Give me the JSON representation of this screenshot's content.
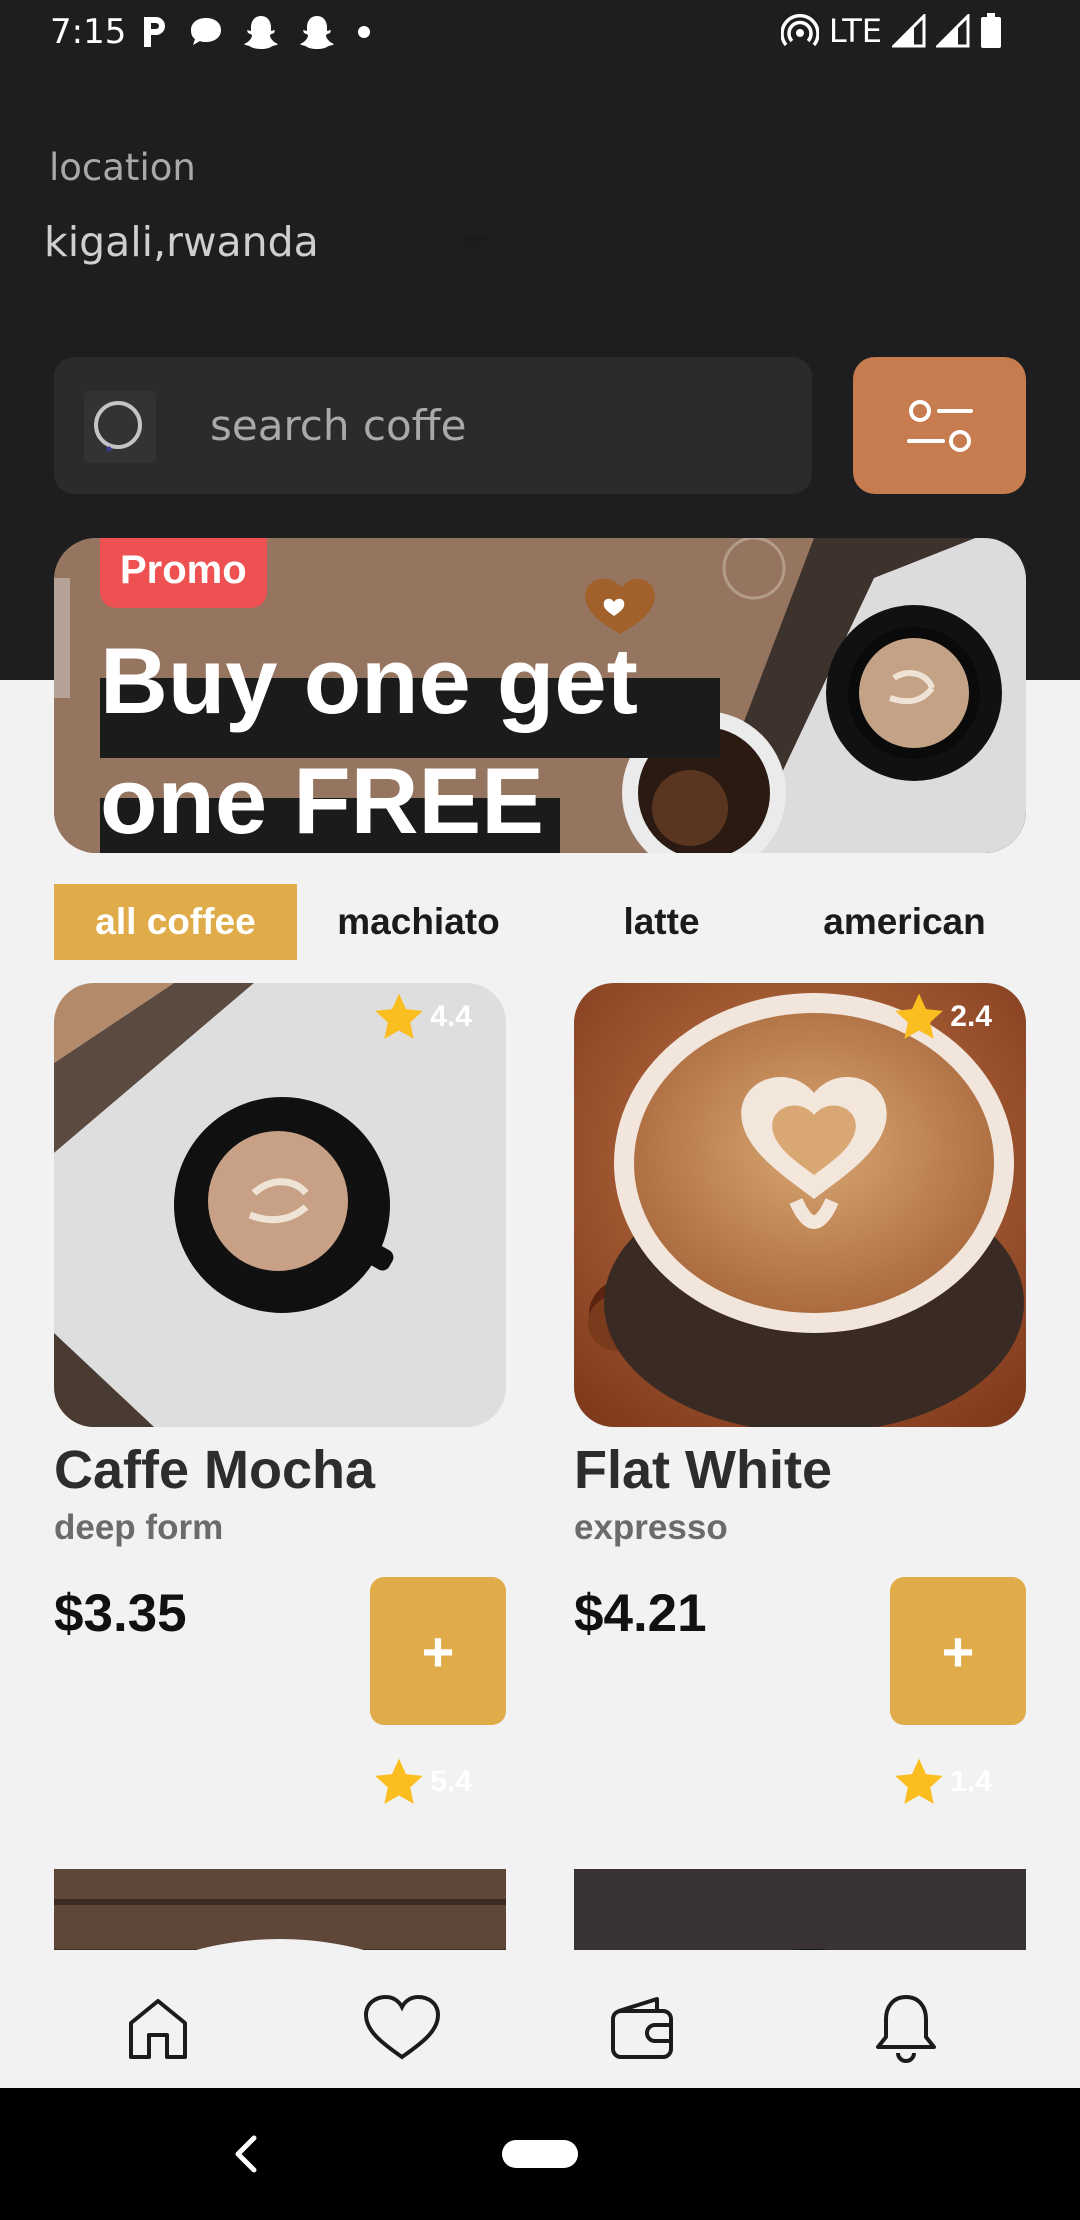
{
  "status_bar": {
    "time": "7:15",
    "network": "LTE",
    "icons": [
      "parking-icon",
      "chat-icon",
      "snapchat-icon",
      "snapchat-icon",
      "dot-icon",
      "hotspot-icon",
      "signal-icon",
      "signal-icon",
      "battery-icon"
    ]
  },
  "location": {
    "label": "location",
    "value": "kigali,rwanda"
  },
  "search": {
    "placeholder": "search coffe"
  },
  "promo": {
    "badge": "Promo",
    "line1": "Buy one get",
    "line2": "one FREE"
  },
  "categories": [
    {
      "label": "all coffee",
      "active": true
    },
    {
      "label": "machiato",
      "active": false
    },
    {
      "label": "latte",
      "active": false
    },
    {
      "label": "american",
      "active": false
    }
  ],
  "products": [
    {
      "name": "Caffe Mocha",
      "subtitle": "deep form",
      "price": "$3.35",
      "rating": "4.4",
      "add_label": "+"
    },
    {
      "name": "Flat White",
      "subtitle": "expresso",
      "price": "$4.21",
      "rating": "2.4",
      "add_label": "+"
    },
    {
      "rating": "5.4"
    },
    {
      "rating": "1.4"
    }
  ],
  "nav": [
    "home-icon",
    "heart-icon",
    "wallet-icon",
    "bell-icon"
  ],
  "colors": {
    "header_bg": "#1e1e20",
    "accent_brown": "#c67c4e",
    "accent_gold": "#e0ac4a",
    "promo_red": "#ed5151",
    "star": "#fbbe21"
  }
}
